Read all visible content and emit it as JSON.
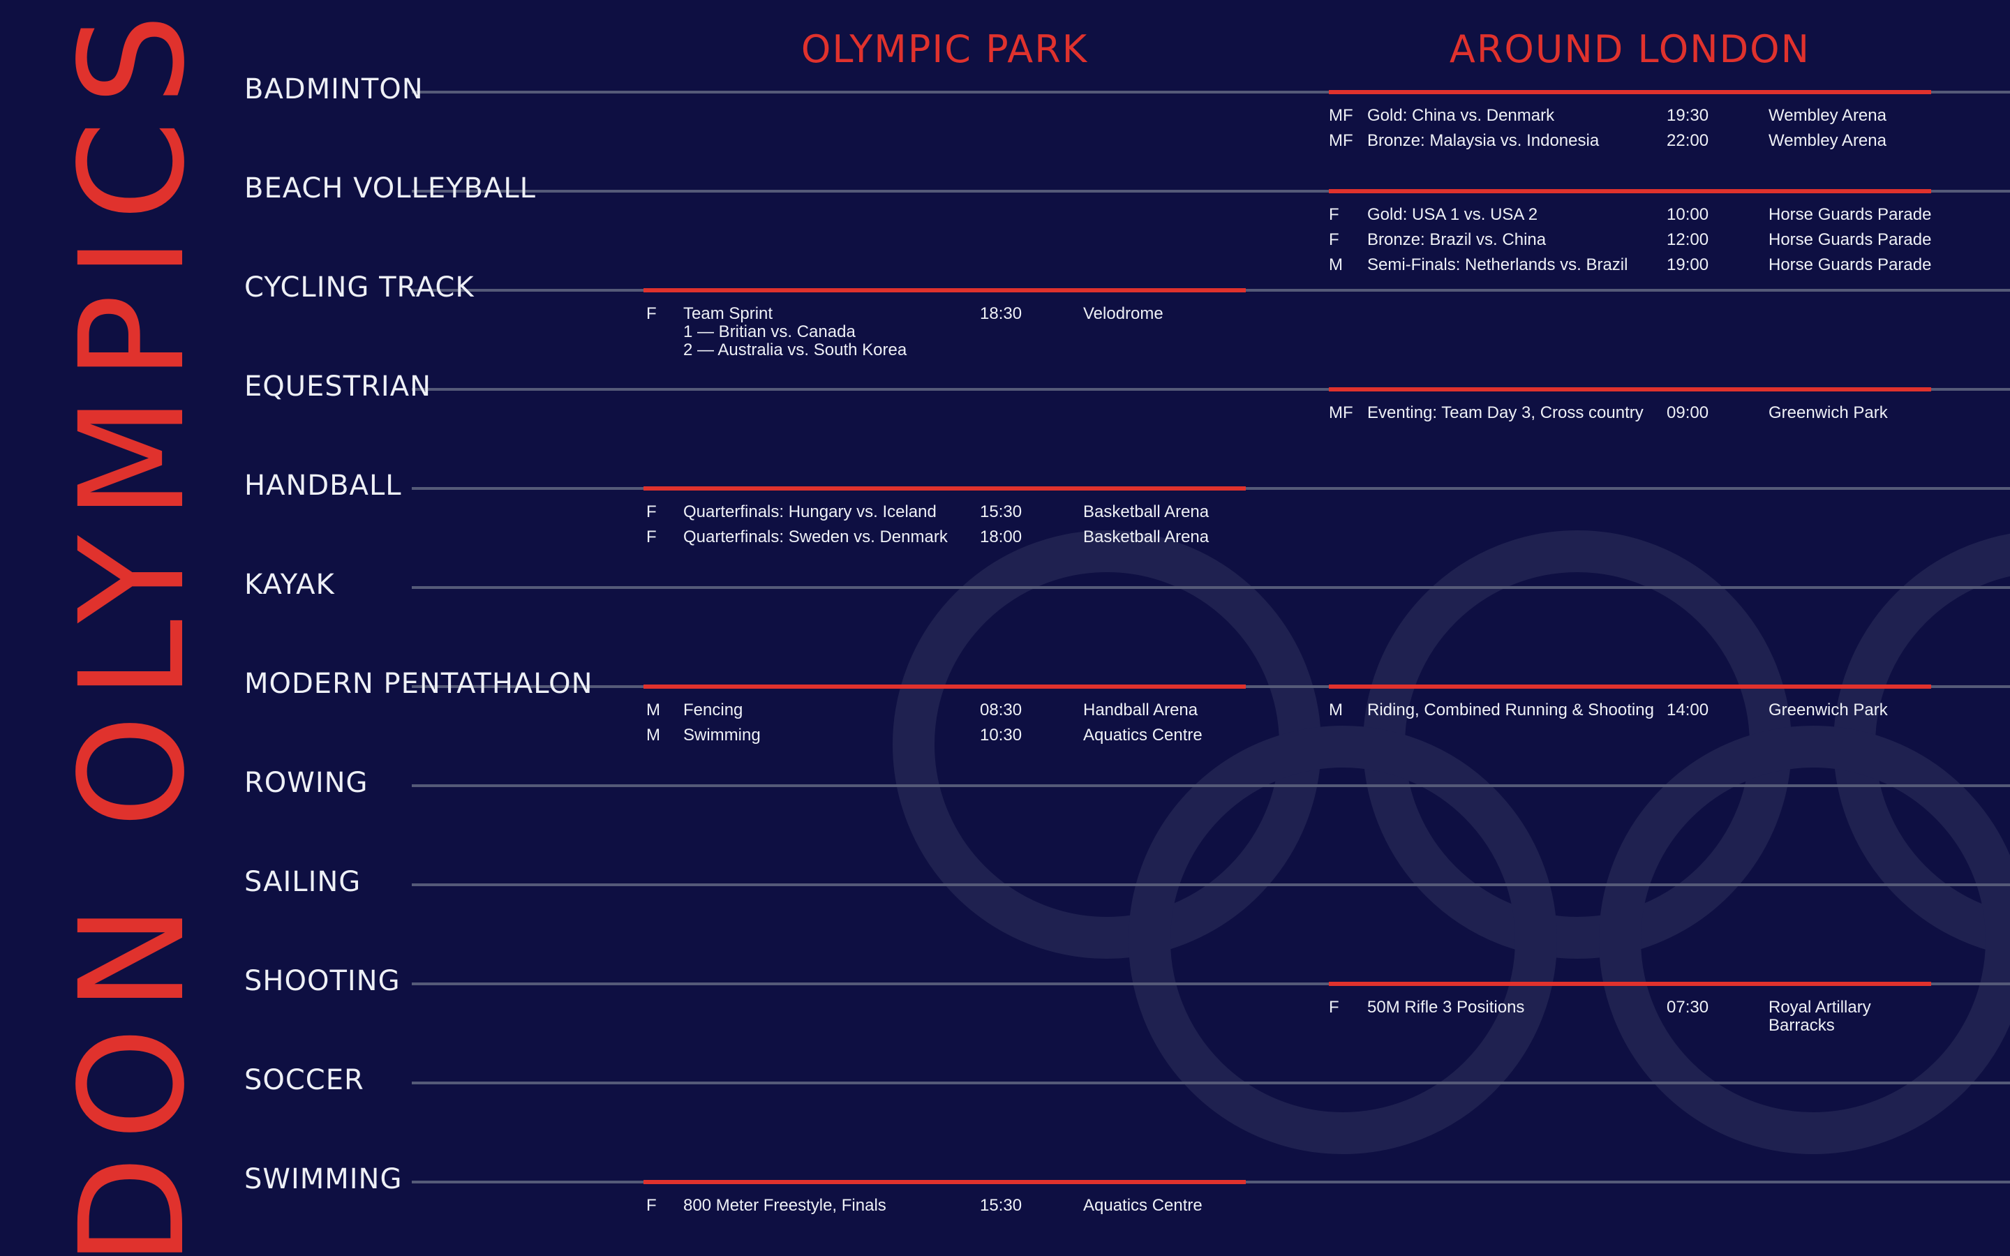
{
  "title": "DON OLYMPICS",
  "columns": {
    "park": "OLYMPIC PARK",
    "london": "AROUND LONDON"
  },
  "colors": {
    "background": "#0e0f42",
    "accent": "#e0322d",
    "text": "#eef0f6",
    "rule": "#555a78"
  },
  "sports": [
    {
      "name": "BADMINTON",
      "park": [],
      "london": [
        {
          "gender": "MF",
          "title": "Gold: China vs. Denmark",
          "time": "19:30",
          "venue": "Wembley Arena"
        },
        {
          "gender": "MF",
          "title": "Bronze: Malaysia vs. Indonesia",
          "time": "22:00",
          "venue": "Wembley Arena"
        }
      ]
    },
    {
      "name": "BEACH VOLLEYBALL",
      "park": [],
      "london": [
        {
          "gender": "F",
          "title": "Gold: USA 1 vs. USA 2",
          "time": "10:00",
          "venue": "Horse Guards Parade"
        },
        {
          "gender": "F",
          "title": "Bronze: Brazil vs. China",
          "time": "12:00",
          "venue": "Horse Guards Parade"
        },
        {
          "gender": "M",
          "title": "Semi-Finals: Netherlands vs. Brazil",
          "time": "19:00",
          "venue": "Horse Guards Parade"
        }
      ]
    },
    {
      "name": "CYCLING TRACK",
      "park": [
        {
          "gender": "F",
          "title": "Team Sprint",
          "time": "18:30",
          "venue": "Velodrome",
          "detail": [
            "1 — Britian vs. Canada",
            "2 — Australia vs. South Korea"
          ]
        }
      ],
      "london": []
    },
    {
      "name": "EQUESTRIAN",
      "park": [],
      "london": [
        {
          "gender": "MF",
          "title": "Eventing: Team Day 3, Cross country",
          "time": "09:00",
          "venue": "Greenwich Park"
        }
      ]
    },
    {
      "name": "HANDBALL",
      "park": [
        {
          "gender": "F",
          "title": "Quarterfinals: Hungary vs. Iceland",
          "time": "15:30",
          "venue": "Basketball Arena"
        },
        {
          "gender": "F",
          "title": "Quarterfinals: Sweden vs. Denmark",
          "time": "18:00",
          "venue": "Basketball Arena"
        }
      ],
      "london": []
    },
    {
      "name": "KAYAK",
      "park": [],
      "london": []
    },
    {
      "name": "MODERN PENTATHALON",
      "park": [
        {
          "gender": "M",
          "title": "Fencing",
          "time": "08:30",
          "venue": "Handball Arena"
        },
        {
          "gender": "M",
          "title": "Swimming",
          "time": "10:30",
          "venue": "Aquatics Centre"
        }
      ],
      "london": [
        {
          "gender": "M",
          "title": "Riding, Combined Running & Shooting",
          "time": "14:00",
          "venue": "Greenwich Park"
        }
      ]
    },
    {
      "name": "ROWING",
      "park": [],
      "london": []
    },
    {
      "name": "SAILING",
      "park": [],
      "london": []
    },
    {
      "name": "SHOOTING",
      "park": [],
      "london": [
        {
          "gender": "F",
          "title": "50M Rifle 3 Positions",
          "time": "07:30",
          "venue": "Royal Artillary",
          "detail": [
            "Barracks"
          ]
        }
      ]
    },
    {
      "name": "SOCCER",
      "park": [],
      "london": []
    },
    {
      "name": "SWIMMING",
      "park": [
        {
          "gender": "F",
          "title": "800 Meter Freestyle, Finals",
          "time": "15:30",
          "venue": "Aquatics Centre"
        }
      ],
      "london": []
    }
  ]
}
